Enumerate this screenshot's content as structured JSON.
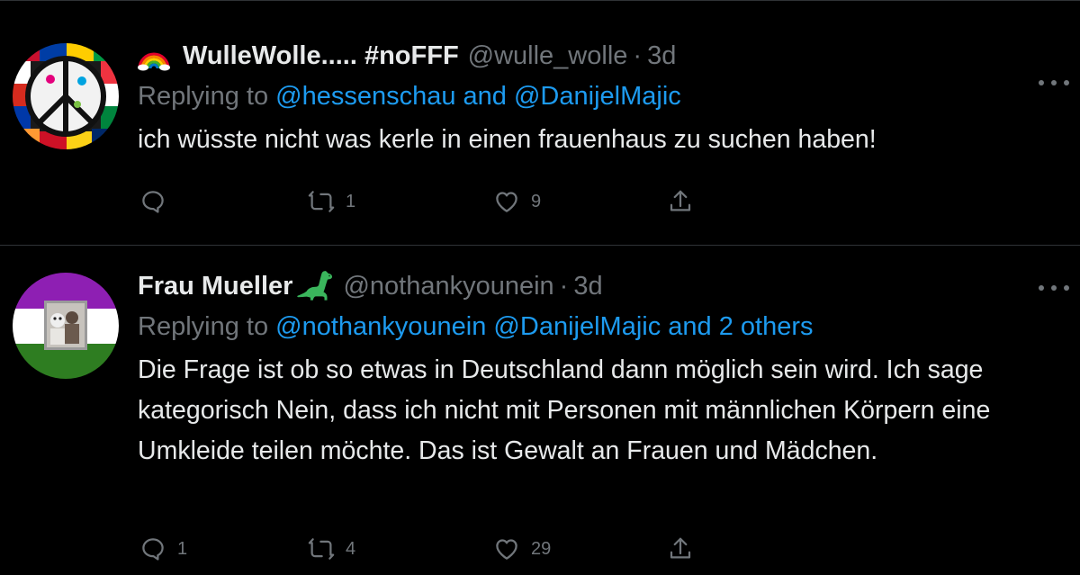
{
  "colors": {
    "background": "#000000",
    "text_primary": "#e7e9ea",
    "text_secondary": "#71767b",
    "link": "#1d9bf0",
    "divider": "#2f3336"
  },
  "tweets": [
    {
      "emoji_before_name": "rainbow-emoji",
      "display_name": "WulleWolle..... #noFFF",
      "handle": "@wulle_wolle",
      "separator": "·",
      "time": "3d",
      "replying_prefix": "Replying to",
      "replying_mentions": "@hessenschau and @DanijelMajic",
      "text": "ich wüsste nicht was kerle in einen frauenhaus zu suchen haben!",
      "actions": {
        "reply_count": "",
        "retweet_count": "1",
        "like_count": "9"
      }
    },
    {
      "emoji_after_name": "sauropod-emoji",
      "display_name": "Frau Mueller",
      "handle": "@nothankyounein",
      "separator": "·",
      "time": "3d",
      "replying_prefix": "Replying to",
      "replying_mentions": "@nothankyounein @DanijelMajic and 2 others",
      "text": "Die Frage ist ob so etwas in Deutschland dann möglich sein wird. Ich sage kategorisch Nein, dass ich nicht mit Personen mit männlichen Körpern eine Umkleide teilen möchte. Das ist Gewalt an Frauen und Mädchen.",
      "actions": {
        "reply_count": "1",
        "retweet_count": "4",
        "like_count": "29"
      }
    }
  ]
}
